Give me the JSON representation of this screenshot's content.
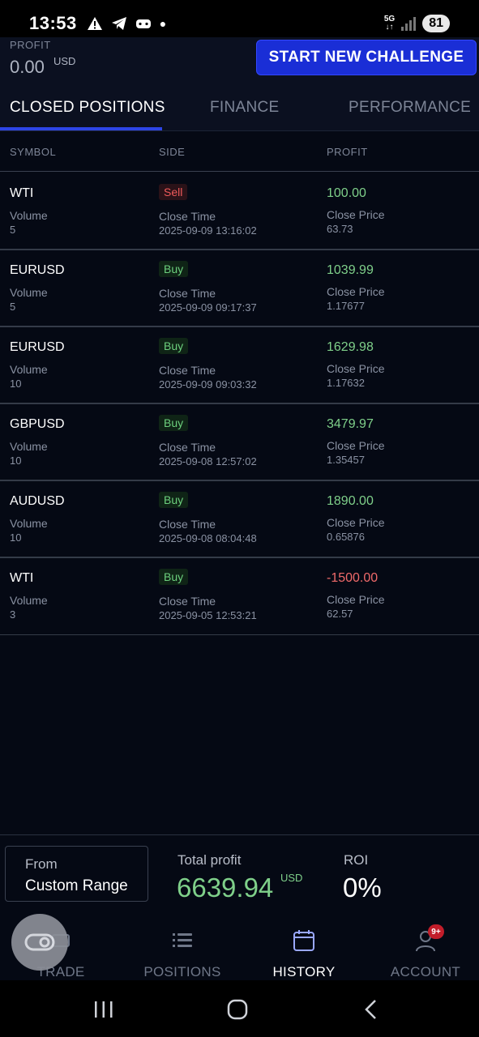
{
  "status_bar": {
    "time": "13:53",
    "network": "5G",
    "battery": "81"
  },
  "header": {
    "profit_label": "PROFIT",
    "profit_value": "0.00",
    "profit_currency": "USD",
    "cta_label": "START NEW CHALLENGE",
    "cta_color": "#1a2ed6"
  },
  "tabs": [
    {
      "label": "CLOSED POSITIONS",
      "active": true
    },
    {
      "label": "FINANCE",
      "active": false
    },
    {
      "label": "PERFORMANCE",
      "active": false
    }
  ],
  "table": {
    "headers": {
      "symbol": "SYMBOL",
      "side": "SIDE",
      "profit": "PROFIT"
    },
    "volume_label": "Volume",
    "close_time_label": "Close Time",
    "close_price_label": "Close Price",
    "rows": [
      {
        "symbol": "WTI",
        "volume": "5",
        "side": "Sell",
        "close_time": "2025-09-09 13:16:02",
        "profit": "100.00",
        "close_price": "63.73"
      },
      {
        "symbol": "EURUSD",
        "volume": "5",
        "side": "Buy",
        "close_time": "2025-09-09 09:17:37",
        "profit": "1039.99",
        "close_price": "1.17677"
      },
      {
        "symbol": "EURUSD",
        "volume": "10",
        "side": "Buy",
        "close_time": "2025-09-09 09:03:32",
        "profit": "1629.98",
        "close_price": "1.17632"
      },
      {
        "symbol": "GBPUSD",
        "volume": "10",
        "side": "Buy",
        "close_time": "2025-09-08 12:57:02",
        "profit": "3479.97",
        "close_price": "1.35457"
      },
      {
        "symbol": "AUDUSD",
        "volume": "10",
        "side": "Buy",
        "close_time": "2025-09-08 08:04:48",
        "profit": "1890.00",
        "close_price": "0.65876"
      },
      {
        "symbol": "WTI",
        "volume": "3",
        "side": "Buy",
        "close_time": "2025-09-05 12:53:21",
        "profit": "-1500.00",
        "close_price": "62.57"
      }
    ]
  },
  "summary": {
    "from_label": "From",
    "from_value": "Custom Range",
    "total_profit_label": "Total profit",
    "total_profit_value": "6639.94",
    "total_profit_currency": "USD",
    "roi_label": "ROI",
    "roi_value": "0%"
  },
  "bottom_nav": {
    "items": [
      {
        "label": "TRADE",
        "icon": "trade-icon"
      },
      {
        "label": "POSITIONS",
        "icon": "list-icon"
      },
      {
        "label": "HISTORY",
        "icon": "calendar-icon",
        "active": true
      },
      {
        "label": "ACCOUNT",
        "icon": "user-icon"
      }
    ],
    "account_badge": "9+"
  },
  "colors": {
    "positive": "#7fd08a",
    "negative": "#f06a6a",
    "accent": "#2d45e6"
  }
}
